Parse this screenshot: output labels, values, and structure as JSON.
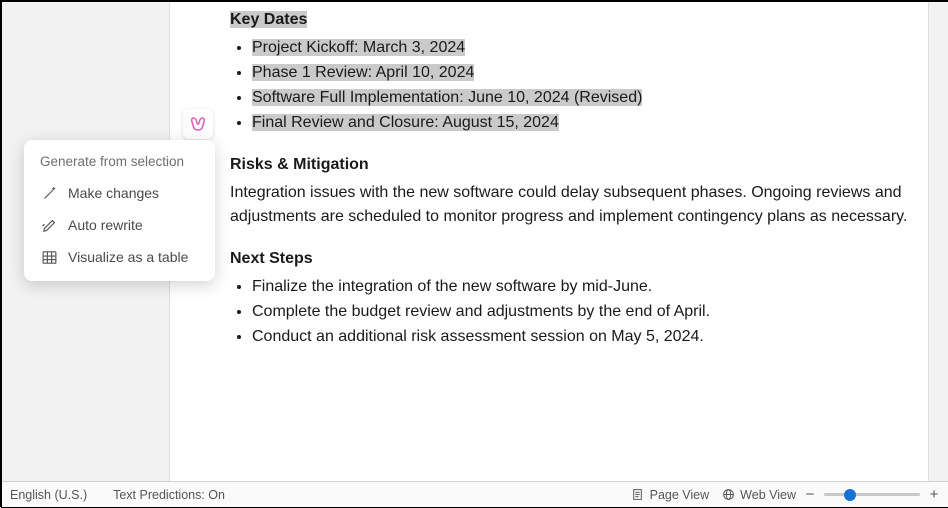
{
  "doc": {
    "headings": {
      "key_dates": "Key Dates",
      "risks": "Risks & Mitigation",
      "next_steps": "Next Steps"
    },
    "key_dates_items": [
      "Project Kickoff: March 3, 2024",
      "Phase 1 Review: April 10, 2024",
      "Software Full Implementation: June 10, 2024 (Revised)",
      "Final Review and Closure: August 15, 2024"
    ],
    "risks_body": "Integration issues with the new software could delay subsequent phases. Ongoing reviews and adjustments are scheduled to monitor progress and implement contingency plans as necessary.",
    "next_steps_items": [
      "Finalize the integration of the new software by mid-June.",
      "Complete the budget review and adjustments by the end of April.",
      "Conduct an additional risk assessment session on May 5, 2024."
    ]
  },
  "ctx": {
    "title": "Generate from selection",
    "items": [
      {
        "label": "Make changes"
      },
      {
        "label": "Auto rewrite"
      },
      {
        "label": "Visualize as a table"
      }
    ]
  },
  "status": {
    "language": "English (U.S.)",
    "text_predictions": "Text Predictions: On",
    "page_view": "Page View",
    "web_view": "Web View"
  }
}
